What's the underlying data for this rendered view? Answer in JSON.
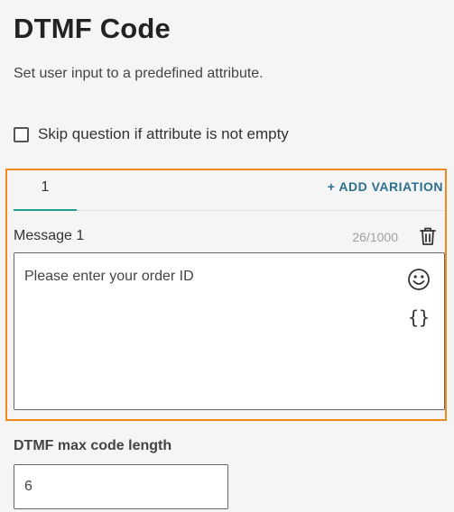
{
  "header": {
    "title": "DTMF Code",
    "subtitle": "Set user input to a predefined attribute."
  },
  "skip": {
    "label": "Skip question if attribute is not empty",
    "checked": false
  },
  "variations": {
    "tabs": [
      {
        "label": "1",
        "active": true
      }
    ],
    "add_label": "+ ADD VARIATION"
  },
  "message": {
    "label": "Message 1",
    "counter": "26/1000",
    "text": "Please enter your order ID",
    "braces_glyph": "{}"
  },
  "max_length": {
    "label": "DTMF max code length",
    "value": "6"
  },
  "colors": {
    "accent_orange": "#f08a1c",
    "tab_teal": "#1fa08c",
    "link_blue": "#2d6f8e"
  }
}
